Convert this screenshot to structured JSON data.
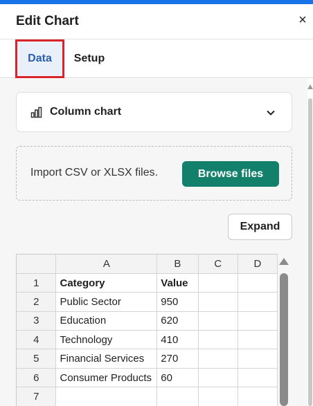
{
  "header": {
    "title": "Edit Chart",
    "close_symbol": "×"
  },
  "tabs": [
    {
      "label": "Data",
      "active": true
    },
    {
      "label": "Setup",
      "active": false
    }
  ],
  "chart_type": {
    "label": "Column chart",
    "icon": "column-chart-icon"
  },
  "import": {
    "text": "Import CSV or XLSX files.",
    "button_label": "Browse files"
  },
  "expand_label": "Expand",
  "spreadsheet": {
    "columns": [
      "A",
      "B",
      "C",
      "D"
    ],
    "rows": [
      {
        "num": "1",
        "cells": [
          "Category",
          "Value",
          "",
          ""
        ]
      },
      {
        "num": "2",
        "cells": [
          "Public Sector",
          "950",
          "",
          ""
        ]
      },
      {
        "num": "3",
        "cells": [
          "Education",
          "620",
          "",
          ""
        ]
      },
      {
        "num": "4",
        "cells": [
          "Technology",
          "410",
          "",
          ""
        ]
      },
      {
        "num": "5",
        "cells": [
          "Financial Services",
          "270",
          "",
          ""
        ]
      },
      {
        "num": "6",
        "cells": [
          "Consumer Products",
          "60",
          "",
          ""
        ]
      },
      {
        "num": "7",
        "cells": [
          "",
          "",
          "",
          ""
        ]
      }
    ]
  },
  "colors": {
    "accent": "#1a73e8",
    "active_tab_outline": "#d9242a",
    "browse_button": "#12806a"
  }
}
